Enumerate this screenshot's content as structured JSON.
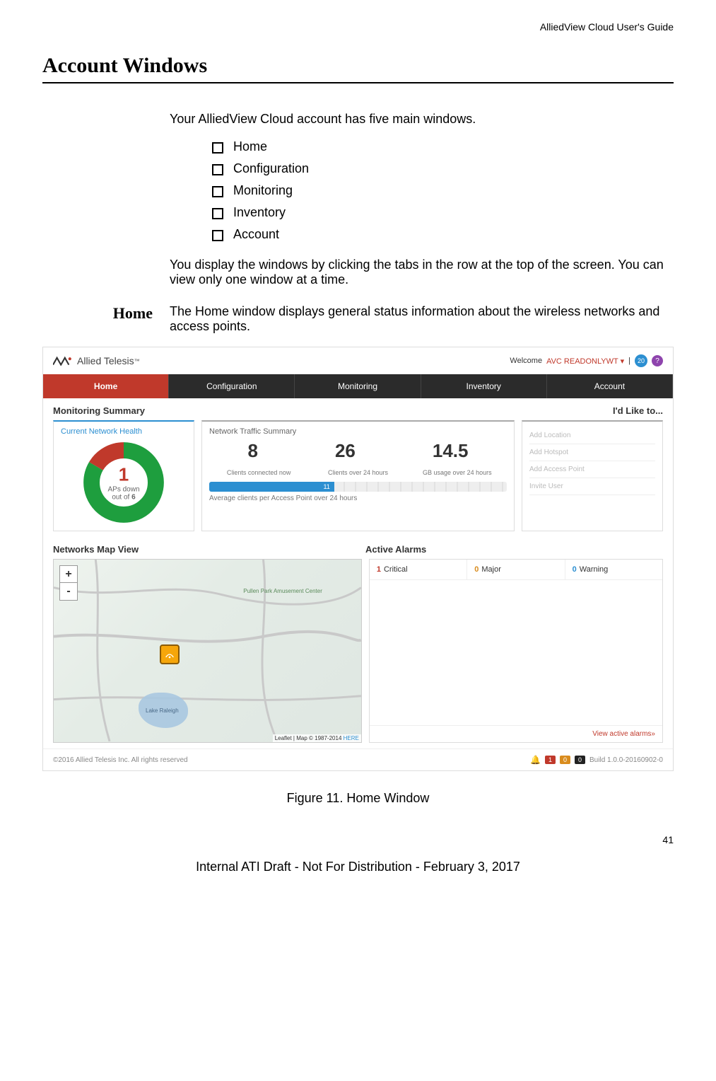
{
  "doc": {
    "header_label": "AlliedView Cloud User's Guide",
    "section_title": "Account Windows",
    "intro": "Your AlliedView Cloud account has five main windows.",
    "windows": [
      "Home",
      "Configuration",
      "Monitoring",
      "Inventory",
      "Account"
    ],
    "tab_desc": "You display the windows by clicking the tabs in the row at the top of the screen. You can view only one window at a time.",
    "home_label": "Home",
    "home_desc": "The Home window displays general status information about the wireless networks and access points.",
    "figure_caption": "Figure 11. Home Window",
    "page_number": "41",
    "internal_draft": "Internal ATI Draft - Not For Distribution - February 3, 2017"
  },
  "screenshot": {
    "brand": "Allied Telesis",
    "welcome_label": "Welcome",
    "user": "AVC READONLYWT",
    "badge_count": "20",
    "nav": [
      "Home",
      "Configuration",
      "Monitoring",
      "Inventory",
      "Account"
    ],
    "sub_left": "Monitoring Summary",
    "sub_right": "I'd Like to...",
    "health": {
      "title": "Current Network Health",
      "aps_down": "1",
      "caption_line1": "APs down",
      "caption_line2_prefix": "out of ",
      "total": "6"
    },
    "traffic": {
      "title": "Network Traffic Summary",
      "stats": [
        {
          "value": "8",
          "label": "Clients connected now"
        },
        {
          "value": "26",
          "label": "Clients over 24 hours"
        },
        {
          "value": "14.5",
          "label": "GB usage over 24 hours"
        }
      ],
      "bar_value": "11",
      "bar_caption": "Average clients per Access Point over 24 hours"
    },
    "like_to": [
      "Add Location",
      "Add Hotspot",
      "Add Access Point",
      "Invite User"
    ],
    "sub2_left": "Networks Map View",
    "sub2_right": "Active Alarms",
    "map": {
      "zoom_in": "+",
      "zoom_out": "-",
      "park": "Pullen Park Amusement Center",
      "lake": "Lake Raleigh",
      "attr_prefix": "Leaflet | Map © 1987-2014 ",
      "attr_link": "HERE"
    },
    "alarms": {
      "critical": {
        "n": "1",
        "label": "Critical"
      },
      "major": {
        "n": "0",
        "label": "Major"
      },
      "warning": {
        "n": "0",
        "label": "Warning"
      },
      "link": "View active alarms»"
    },
    "footer": {
      "copyright": "©2016 Allied Telesis Inc. All rights reserved",
      "badges": [
        "1",
        "0",
        "0"
      ],
      "build": "Build 1.0.0-20160902-0"
    }
  },
  "chart_data": {
    "type": "pie",
    "title": "Current Network Health",
    "categories": [
      "APs up",
      "APs down"
    ],
    "values": [
      5,
      1
    ],
    "colors": [
      "#1e9e3e",
      "#c0392b"
    ],
    "center_label": "1 APs down out of 6"
  }
}
